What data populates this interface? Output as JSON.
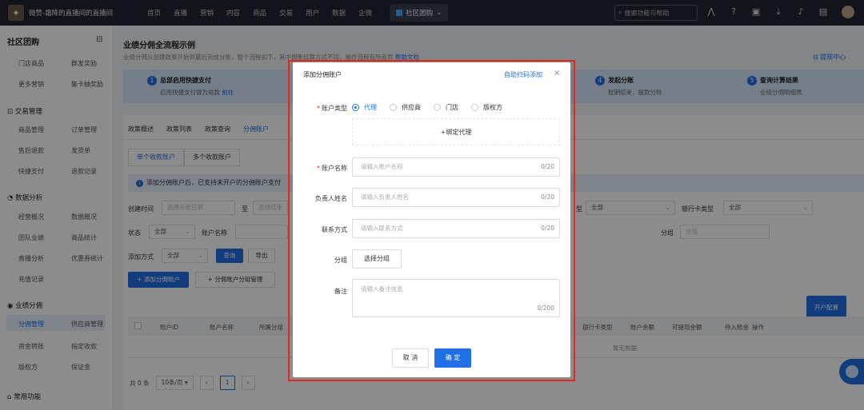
{
  "topnav": {
    "shop_name": "微赞-霜降的直播间的直播间",
    "items": [
      "首页",
      "直播",
      "营销",
      "内容",
      "商品",
      "交易",
      "用户",
      "数据",
      "企微"
    ],
    "pill": "社区团购",
    "search_placeholder": "搜索功能与帮助"
  },
  "sidebar": {
    "title": "社区团购",
    "links_top": [
      "门店商品",
      "群发奖励",
      "更多营销",
      "集卡抽奖励"
    ],
    "group_trade": "交易管理",
    "trade_links": [
      "商品管理",
      "订单管理",
      "售后退款",
      "发货单",
      "快捷支付",
      "退款记录"
    ],
    "group_data": "数据分析",
    "data_links": [
      "经营概况",
      "数据概况",
      "团队业绩",
      "商品统计",
      "直播分析",
      "优惠券统计",
      "充值记录"
    ],
    "group_perf": "业绩分佣",
    "perf_links": [
      "分佣管理",
      "供应商管理",
      "资金转账",
      "指定收款",
      "版权方",
      "保证金"
    ],
    "group_common": "常用功能"
  },
  "main": {
    "title": "业绩分佣全流程示例",
    "desc": "业绩分佣从创建政策开始到最后完成分账，整个流程如下，其中佣账结算方式不同，操作流程有所差异",
    "desc_link": "帮助文档",
    "withdraw": "提现中心",
    "steps": [
      {
        "num": "1",
        "title": "总部启用快捷支付",
        "desc": "启用快捷支付做为收款",
        "link": "前往"
      },
      {
        "num": "4",
        "title": "发起分账",
        "desc": "账期结束，提款分账"
      },
      {
        "num": "5",
        "title": "查询计算结果",
        "desc": "业绩分佣明细表"
      }
    ],
    "tabs": [
      "政策概述",
      "政策列表",
      "政策查询",
      "分佣账户"
    ],
    "subtabs": [
      "单个收款账户",
      "多个收款账户"
    ],
    "info": "添加分佣账户后，已支持未开户的分佣账户支付",
    "filters": {
      "create_time": "创建时间",
      "start_placeholder": "选择开始日期",
      "to": "至",
      "end_placeholder": "选择结束",
      "type_label": "型",
      "type_value": "全部",
      "bank_label": "银行卡类型",
      "bank_value": "全部",
      "status_label": "状态",
      "status_value": "全部",
      "account_label": "账户名称",
      "group_label": "分组",
      "group_value": "分组",
      "add_method_label": "添加方式",
      "add_method_value": "全部",
      "query": "查询",
      "export": "导出"
    },
    "actions": {
      "add_account": "+ 添加分佣账户",
      "grouping": "+ 分佣账户分组管理",
      "open_config": "开户配置"
    },
    "table_headers": [
      "账户ID",
      "账户名称",
      "所属分组",
      "银行卡类型",
      "账户余额",
      "可提现金额",
      "待入账金",
      "操作"
    ],
    "empty": "暂无数据",
    "pager": {
      "total": "共 0 条",
      "size": "10条/页",
      "page": "1"
    }
  },
  "modal": {
    "title": "添加分佣账户",
    "scan_link": "自助扫码添加",
    "account_type_label": "账户类型",
    "account_types": [
      "代理",
      "供应商",
      "门店",
      "版权方"
    ],
    "bind_agent": "+绑定代理",
    "account_name_label": "账户名称",
    "account_name_placeholder": "请输入账户名称",
    "account_name_count": "0/20",
    "owner_label": "负责人姓名",
    "owner_placeholder": "请输入负责人姓名",
    "owner_count": "0/20",
    "contact_label": "联系方式",
    "contact_placeholder": "请输入联系方式",
    "contact_count": "0/20",
    "group_label": "分组",
    "group_button": "选择分组",
    "note_label": "备注",
    "note_placeholder": "请输入备注信息",
    "note_count": "0/200",
    "cancel": "取 消",
    "confirm": "确 定"
  },
  "colors": {
    "accent": "#1f6fe5",
    "highlight": "#e0281e",
    "nav_bg": "#23262e"
  }
}
